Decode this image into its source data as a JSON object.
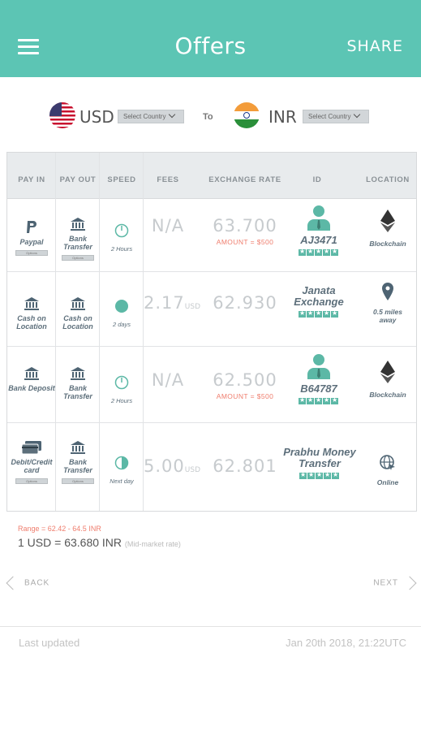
{
  "header": {
    "title": "Offers",
    "share_label": "SHARE",
    "menu_icon": "hamburger-icon",
    "color": "#5cc5b4"
  },
  "currency": {
    "from_code": "USD",
    "from_select": "Select Country",
    "to_label": "To",
    "to_code": "INR",
    "to_select": "Select Country"
  },
  "table": {
    "columns": [
      "PAY IN",
      "PAY OUT",
      "SPEED",
      "FEES",
      "EXCHANGE RATE",
      "ID",
      "LOCATION"
    ],
    "rows": [
      {
        "pay_in": "Paypal",
        "pay_in_icon": "paypal-icon",
        "pay_in_options": "Options",
        "pay_out": "Bank Transfer",
        "pay_out_icon": "bank-icon",
        "pay_out_options": "Options",
        "speed": "2 Hours",
        "speed_icon": "clock-outline-icon",
        "fees": "N/A",
        "fees_unit": "",
        "rate": "63.700",
        "amount": "AMOUNT = $500",
        "id": "AJ3471",
        "id_icon": "person-icon",
        "rating": 5,
        "location": "Blockchain",
        "location_icon": "ethereum-icon"
      },
      {
        "pay_in": "Cash on Location",
        "pay_in_icon": "bank-icon",
        "pay_in_options": "",
        "pay_out": "Cash on Location",
        "pay_out_icon": "bank-icon",
        "pay_out_options": "",
        "speed": "2 days",
        "speed_icon": "filled-dot-icon",
        "fees": "2.17",
        "fees_unit": "USD",
        "rate": "62.930",
        "amount": "",
        "id": "Janata Exchange",
        "id_icon": "",
        "rating": 5,
        "location": "0.5 miles away",
        "location_icon": "map-pin-icon"
      },
      {
        "pay_in": "Bank Deposit",
        "pay_in_icon": "bank-icon",
        "pay_in_options": "",
        "pay_out": "Bank Transfer",
        "pay_out_icon": "bank-icon",
        "pay_out_options": "",
        "speed": "2 Hours",
        "speed_icon": "clock-outline-icon",
        "fees": "N/A",
        "fees_unit": "",
        "rate": "62.500",
        "amount": "AMOUNT = $500",
        "id": "B64787",
        "id_icon": "person-icon",
        "rating": 5,
        "location": "Blockchain",
        "location_icon": "ethereum-icon"
      },
      {
        "pay_in": "Debit/Credit card",
        "pay_in_icon": "card-icon",
        "pay_in_options": "Options",
        "pay_out": "Bank Transfer",
        "pay_out_icon": "bank-icon",
        "pay_out_options": "Options",
        "speed": "Next day",
        "speed_icon": "half-clock-icon",
        "fees": "5.00",
        "fees_unit": "USD",
        "rate": "62.801",
        "amount": "",
        "id": "Prabhu Money Transfer",
        "id_icon": "",
        "rating": 5,
        "location": "Online",
        "location_icon": "globe-icon"
      }
    ]
  },
  "summary": {
    "range": "Range = 62.42 - 64.5 INR",
    "rate": "1 USD = 63.680 INR",
    "rate_note": "(Mid-market rate)"
  },
  "nav": {
    "back": "BACK",
    "next": "NEXT"
  },
  "footer": {
    "last_updated_label": "Last updated",
    "timestamp": "Jan 20th 2018, 21:22UTC"
  },
  "colors": {
    "accent": "#5cc5b4",
    "amount": "#ef7d6d",
    "muted_number": "#c7cbce",
    "label": "#5d6f7b"
  }
}
